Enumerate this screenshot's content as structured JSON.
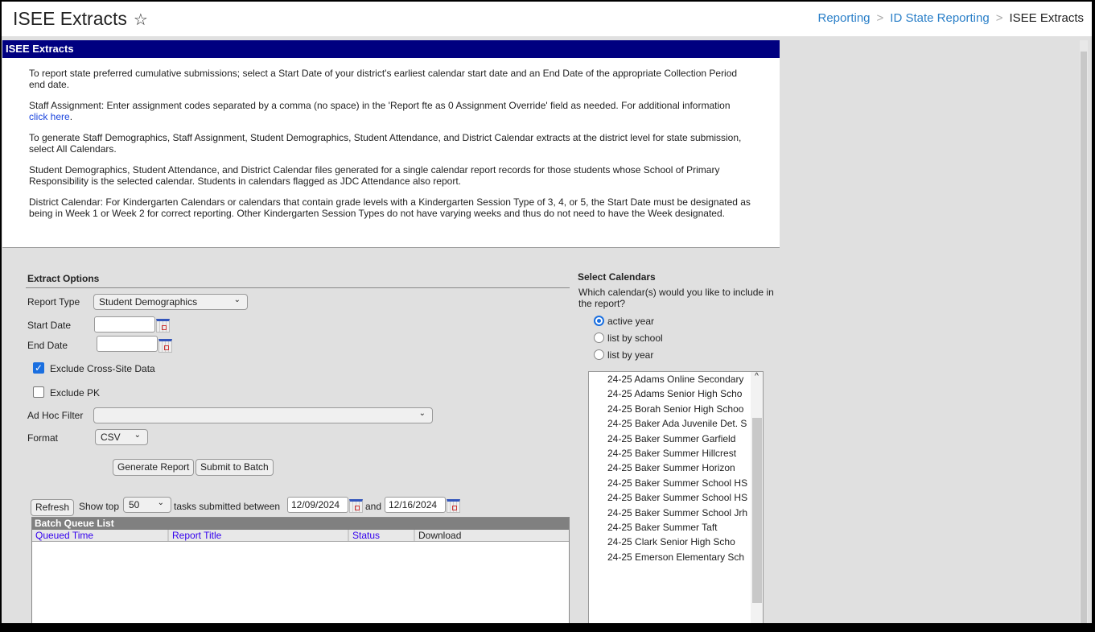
{
  "header": {
    "title": "ISEE Extracts",
    "breadcrumbs": [
      "Reporting",
      "ID State Reporting",
      "ISEE Extracts"
    ]
  },
  "panel": {
    "title": "ISEE Extracts",
    "info": [
      "To report state preferred cumulative submissions; select a Start Date of your district's earliest calendar start date and an End Date of the appropriate Collection Period end date.",
      "Staff Assignment: Enter assignment codes separated by a comma (no space) in the 'Report fte as 0 Assignment Override' field as needed. For additional information",
      "To generate Staff Demographics, Staff Assignment, Student Demographics, Student Attendance, and District Calendar extracts at the district level for state submission, select All Calendars.",
      "Student Demographics, Student Attendance, and District Calendar files generated for a single calendar report records for those students whose School of Primary Responsibility is the selected calendar. Students in calendars flagged as JDC Attendance also report.",
      "District Calendar: For Kindergarten Calendars or calendars that contain grade levels with a Kindergarten Session Type of 3, 4, or 5, the Start Date must be designated as being in Week 1 or Week 2 for correct reporting. Other Kindergarten Session Types do not have varying weeks and thus do not need to have the Week designated."
    ],
    "click_here": "click here"
  },
  "extract": {
    "heading": "Extract Options",
    "report_type_label": "Report Type",
    "report_type": "Student Demographics",
    "start_label": "Start Date",
    "start": "",
    "end_label": "End Date",
    "end": "",
    "cross_site_label": "Exclude Cross-Site Data",
    "cross_site": true,
    "exclude_pk_label": "Exclude PK",
    "exclude_pk": false,
    "adhoc_label": "Ad Hoc Filter",
    "adhoc": "",
    "format_label": "Format",
    "format": "CSV",
    "generate": "Generate Report",
    "submit": "Submit to Batch"
  },
  "batch": {
    "refresh": "Refresh",
    "show_top": "Show top",
    "top": "50",
    "between": "tasks submitted between",
    "from": "12/09/2024",
    "and": "and",
    "to": "12/16/2024",
    "title": "Batch Queue List",
    "columns": [
      "Queued Time",
      "Report Title",
      "Status",
      "Download"
    ]
  },
  "calendars": {
    "heading": "Select Calendars",
    "question": "Which calendar(s) would you like to include in the report?",
    "options": [
      "active year",
      "list by school",
      "list by year"
    ],
    "selected": "active year",
    "items": [
      "24-25 Adams Online Secondary",
      "24-25 Adams Senior High Scho",
      "24-25 Borah Senior High Schoo",
      "24-25 Baker Ada Juvenile Det. S",
      "24-25 Baker Summer Garfield",
      "24-25 Baker Summer Hillcrest",
      "24-25 Baker Summer Horizon",
      "24-25 Baker Summer School HS",
      "24-25 Baker Summer School HS",
      "24-25 Baker Summer School Jrh",
      "24-25 Baker Summer Taft",
      "24-25 Clark Senior High Scho",
      "24-25 Emerson Elementary Sch"
    ]
  }
}
